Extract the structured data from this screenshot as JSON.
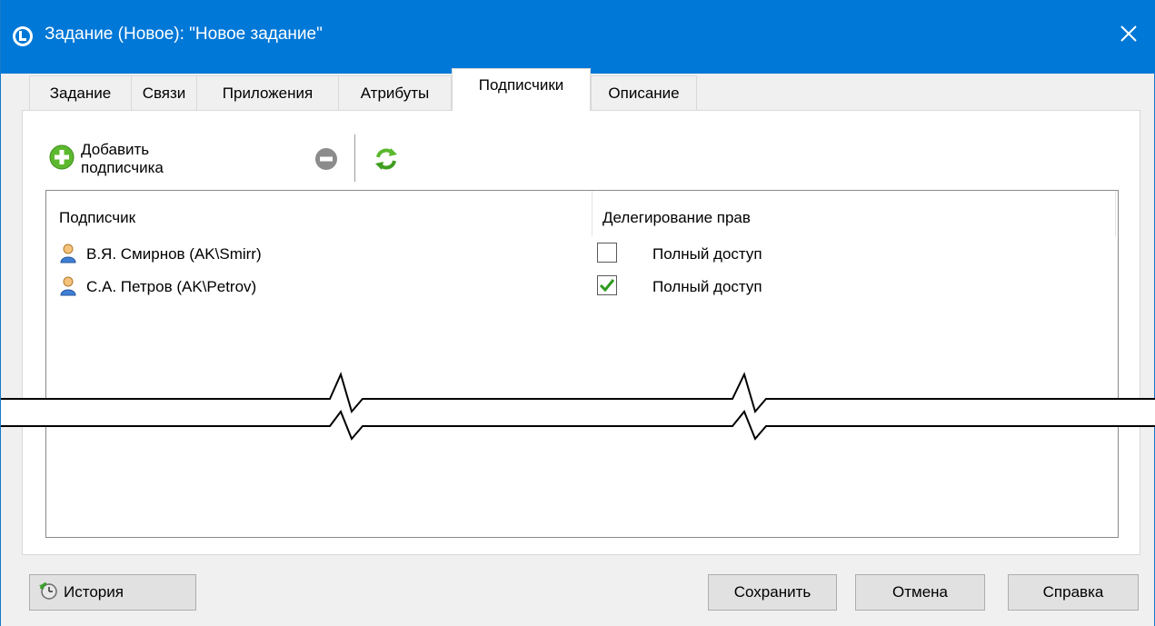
{
  "window": {
    "title": "Задание (Новое): \"Новое задание\"",
    "accent_color": "#0078d7",
    "app_icon": "app-logo-icon",
    "close_icon": "close-icon"
  },
  "tabs": [
    {
      "label": "Задание",
      "active": false
    },
    {
      "label": "Связи",
      "active": false
    },
    {
      "label": "Приложения",
      "active": false
    },
    {
      "label": "Атрибуты",
      "active": false
    },
    {
      "label": "Подписчики",
      "active": true
    },
    {
      "label": "Описание",
      "active": false
    }
  ],
  "toolbar": {
    "add_label": "Добавить подписчика",
    "add_icon": "plus-circle-icon",
    "remove_icon": "minus-circle-icon",
    "refresh_icon": "refresh-icon"
  },
  "grid": {
    "columns": [
      "Подписчик",
      "Делегирование прав"
    ],
    "rows": [
      {
        "subscriber": "В.Я. Смирнов (AK\\Smirr)",
        "rights_label": "Полный доступ",
        "checked": false
      },
      {
        "subscriber": "С.А. Петров (AK\\Petrov)",
        "rights_label": "Полный доступ",
        "checked": true
      }
    ]
  },
  "buttons": {
    "history": "История",
    "save": "Сохранить",
    "cancel": "Отмена",
    "help": "Справка"
  }
}
